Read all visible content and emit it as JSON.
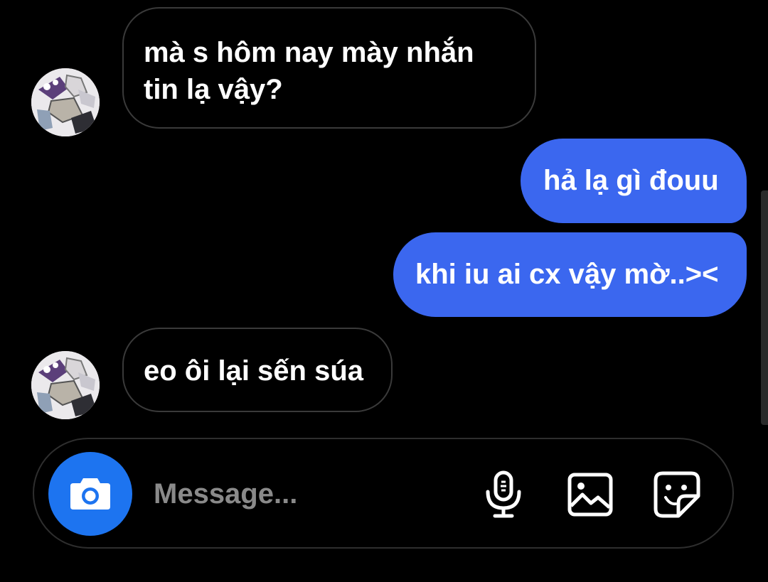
{
  "conversation": {
    "messages": [
      {
        "direction": "incoming",
        "text": "mà s hôm nay mày nhắn tin lạ vậy?"
      },
      {
        "direction": "outgoing",
        "text": "hả lạ gì đouu"
      },
      {
        "direction": "outgoing",
        "text": "khi iu ai cx vậy mờ..><"
      },
      {
        "direction": "incoming",
        "text": "eo ôi lại sến súa"
      }
    ]
  },
  "composer": {
    "placeholder": "Message...",
    "value": "",
    "icons": {
      "camera": "camera-icon",
      "mic": "microphone-icon",
      "gallery": "image-gallery-icon",
      "sticker": "sticker-icon"
    }
  },
  "colors": {
    "background": "#000000",
    "outgoing_bubble": "#3b67ef",
    "incoming_border": "#3a3a3a",
    "camera_button": "#1d74f0",
    "placeholder": "#8a8a8a"
  }
}
